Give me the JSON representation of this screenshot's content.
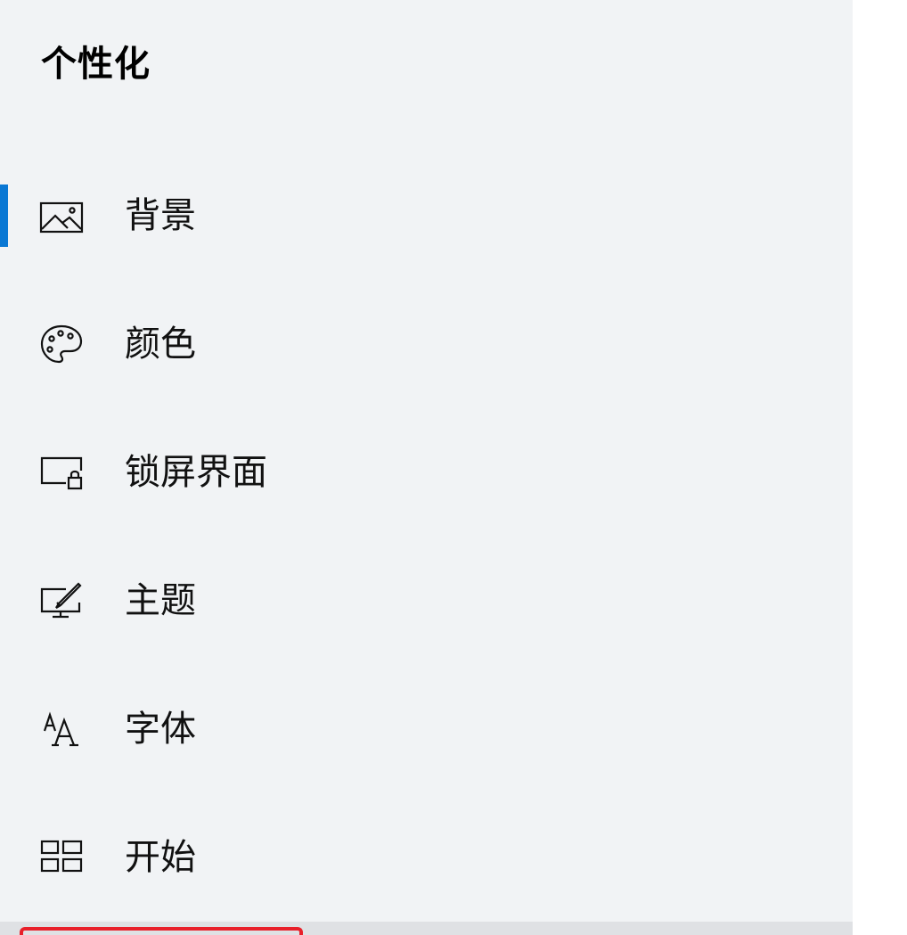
{
  "header": {
    "title": "个性化"
  },
  "nav": {
    "selected_index": 0,
    "accent_color": "#0a78d4",
    "items": [
      {
        "label": "背景",
        "icon": "picture-icon"
      },
      {
        "label": "颜色",
        "icon": "palette-icon"
      },
      {
        "label": "锁屏界面",
        "icon": "lock-screen-icon"
      },
      {
        "label": "主题",
        "icon": "theme-brush-icon"
      },
      {
        "label": "字体",
        "icon": "font-icon"
      },
      {
        "label": "开始",
        "icon": "start-tiles-icon"
      }
    ]
  },
  "highlight": {
    "color": "#e8202a"
  }
}
